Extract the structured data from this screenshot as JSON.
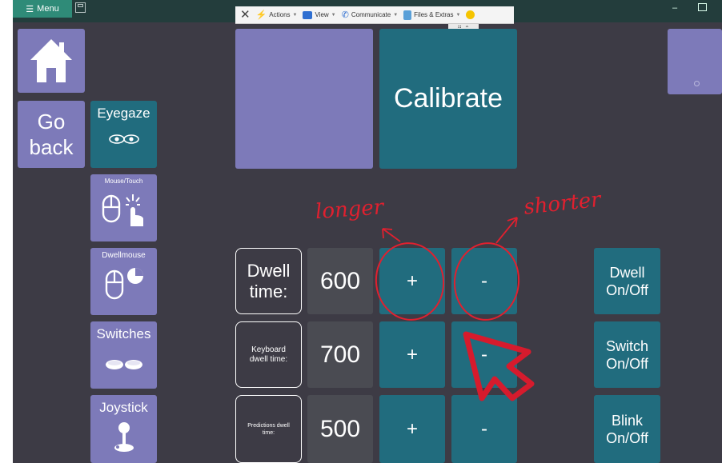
{
  "topbar": {
    "menu_label": "Menu",
    "menu_icon": "hamburger-icon",
    "minimize_glyph": "–"
  },
  "remote_toolbar": {
    "items": [
      {
        "label": "Actions",
        "icon": "lightning-icon",
        "color": "#f2b600"
      },
      {
        "label": "View",
        "icon": "monitor-icon",
        "color": "#2f6fd1"
      },
      {
        "label": "Communicate",
        "icon": "phone-icon",
        "color": "#2f6fd1"
      },
      {
        "label": "Files & Extras",
        "icon": "files-icon",
        "color": "#5aa0d8"
      }
    ],
    "collapse_label": "⌃"
  },
  "nav": {
    "go_back_line1": "Go",
    "go_back_line2": "back"
  },
  "access_methods": [
    {
      "label": "Eyegaze",
      "icon": "eyes-icon"
    },
    {
      "label": "Mouse/Touch",
      "icon": "mouse-touch-icon"
    },
    {
      "label": "Dwellmouse",
      "icon": "dwell-mouse-icon"
    },
    {
      "label": "Switches",
      "icon": "switches-icon"
    },
    {
      "label": "Joystick",
      "icon": "joystick-icon"
    }
  ],
  "calibrate_label": "Calibrate",
  "settings": [
    {
      "label_line1": "Dwell",
      "label_line2": "time:",
      "value": "600",
      "plus": "+",
      "minus": "-"
    },
    {
      "label_line1": "Keyboard",
      "label_line2": "dwell time:",
      "value": "700",
      "plus": "+",
      "minus": "-"
    },
    {
      "label_line1": "Predictions dwell",
      "label_line2": "time:",
      "value": "500",
      "plus": "+",
      "minus": "-"
    }
  ],
  "toggles": [
    {
      "line1": "Dwell",
      "line2": "On/Off"
    },
    {
      "line1": "Switch",
      "line2": "On/Off"
    },
    {
      "line1": "Blink",
      "line2": "On/Off"
    }
  ],
  "annotations": {
    "longer": "longer",
    "shorter": "shorter",
    "ink_color": "#e0202f"
  },
  "colors": {
    "background": "#3d3b45",
    "purple_tile": "#7d7ab9",
    "teal_tile": "#216c7e",
    "grey_tile": "#4a4b52",
    "menu_green": "#2f8b78"
  }
}
